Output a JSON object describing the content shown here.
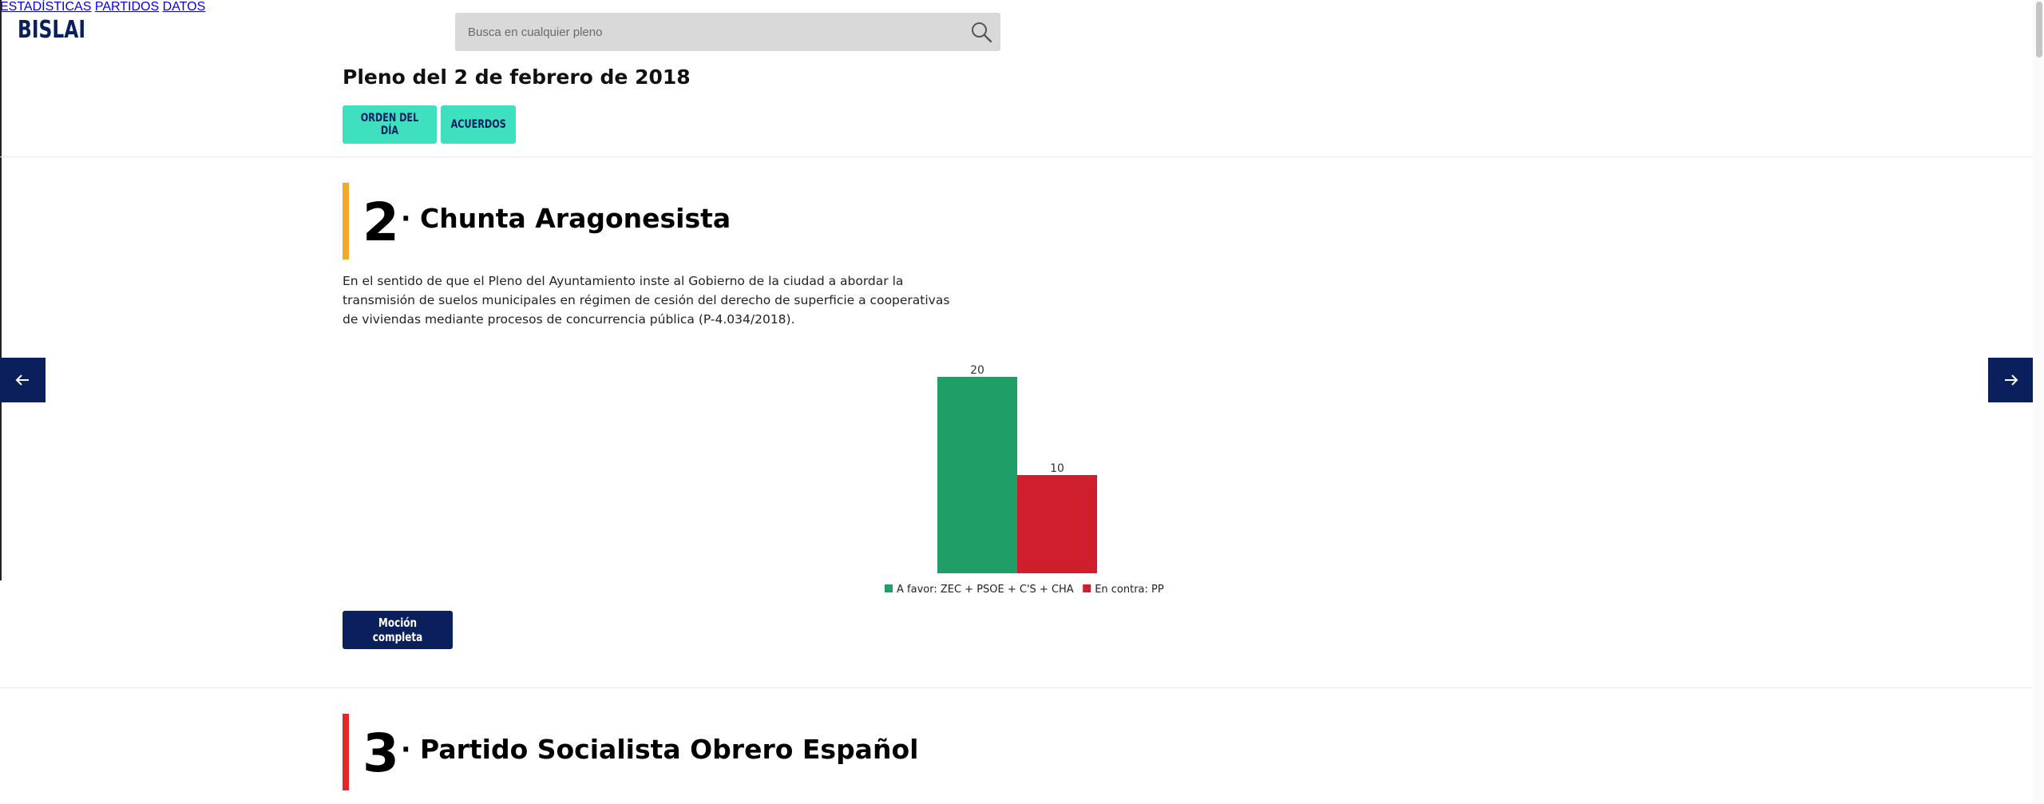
{
  "header": {
    "logo": "BISLAI",
    "search_placeholder": "Busca en cualquier pleno",
    "nav": [
      "ESTADÍSTICAS",
      "PARTIDOS",
      "DATOS"
    ]
  },
  "page": {
    "title": "Pleno del 2 de febrero de 2018",
    "tabs": [
      "ORDEN DEL DÍA",
      "ACUERDOS"
    ]
  },
  "items": [
    {
      "number": "2",
      "party": "· Chunta Aragonesista",
      "accent_color": "#f0a92b",
      "description": "En el sentido de que el Pleno del Ayuntamiento inste al Gobierno de la ciudad a abordar la transmisión de suelos municipales en régimen de cesión del derecho de superficie a cooperativas de viviendas mediante procesos de concurrencia pública (P-4.034/2018).",
      "button_label": "Moción completa"
    },
    {
      "number": "3",
      "party": "· Partido Socialista Obrero Español",
      "accent_color": "#e3262a"
    }
  ],
  "icons": {
    "search": "search-icon",
    "prev": "arrow-left-icon",
    "next": "arrow-right-icon"
  },
  "chart_data": {
    "type": "bar",
    "categories": [
      "A favor: ZEC + PSOE + C'S + CHA",
      "En contra: PP"
    ],
    "values": [
      20,
      10
    ],
    "colors": [
      "#1f9e68",
      "#d01f2c"
    ],
    "data_labels": [
      "20",
      "10"
    ],
    "legend": [
      "A favor: ZEC + PSOE + C'S + CHA",
      "En contra: PP"
    ],
    "legend_position": "bottom",
    "ylim": [
      0,
      20
    ],
    "grid": false
  }
}
